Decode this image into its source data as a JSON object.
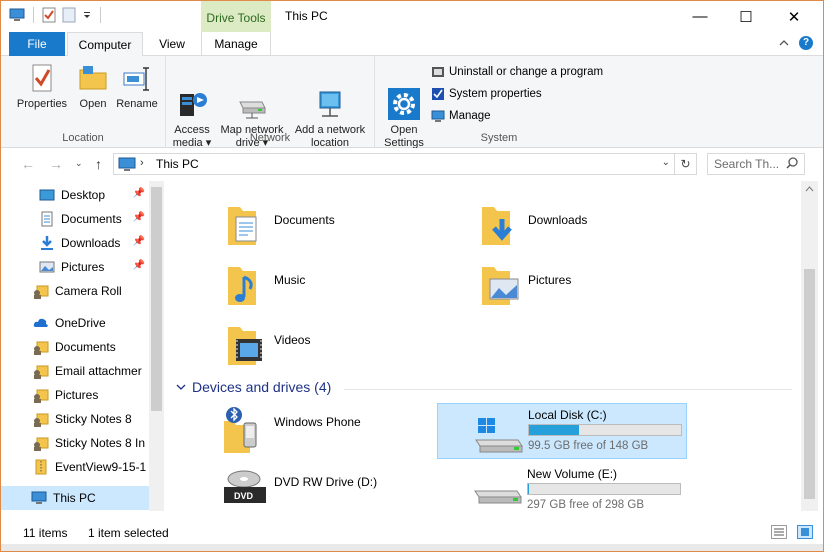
{
  "titlebar": {
    "contextual_tab": "Drive Tools",
    "title": "This PC",
    "minimize": "—",
    "maximize": "☐",
    "close": "✕"
  },
  "tabs": {
    "file": "File",
    "computer": "Computer",
    "view": "View",
    "manage": "Manage"
  },
  "ribbon": {
    "location": {
      "label": "Location",
      "properties": "Properties",
      "open": "Open",
      "rename": "Rename"
    },
    "network": {
      "label": "Network",
      "access_media": "Access\nmedia ▾",
      "map_drive": "Map network\ndrive ▾",
      "add_location": "Add a network\nlocation"
    },
    "system": {
      "label": "System",
      "open_settings": "Open\nSettings",
      "uninstall": "Uninstall or change a program",
      "system_properties": "System properties",
      "manage": "Manage"
    }
  },
  "address": {
    "crumb": "This PC",
    "search_placeholder": "Search Th..."
  },
  "navpane": {
    "items": [
      {
        "label": "Desktop",
        "pinned": true
      },
      {
        "label": "Documents",
        "pinned": true
      },
      {
        "label": "Downloads",
        "pinned": true
      },
      {
        "label": "Pictures",
        "pinned": true
      },
      {
        "label": "Camera Roll",
        "pinned": false
      },
      {
        "label": "OneDrive",
        "pinned": false
      },
      {
        "label": "Documents",
        "pinned": false
      },
      {
        "label": "Email attachmer",
        "pinned": false
      },
      {
        "label": "Pictures",
        "pinned": false
      },
      {
        "label": "Sticky Notes 8",
        "pinned": false
      },
      {
        "label": "Sticky Notes 8 In",
        "pinned": false
      },
      {
        "label": "EventView9-15-1",
        "pinned": false
      },
      {
        "label": "This PC",
        "pinned": false
      }
    ]
  },
  "folders": [
    {
      "name": "Documents"
    },
    {
      "name": "Downloads"
    },
    {
      "name": "Music"
    },
    {
      "name": "Pictures"
    },
    {
      "name": "Videos"
    }
  ],
  "devices": {
    "heading": "Devices and drives (4)",
    "items": [
      {
        "name": "Windows Phone"
      },
      {
        "name": "Local Disk (C:)",
        "free_text": "99.5 GB free of 148 GB",
        "used_fraction": 0.328
      },
      {
        "name": "DVD RW Drive (D:)"
      },
      {
        "name": "New Volume (E:)",
        "free_text": "297 GB free of 298 GB",
        "used_fraction": 0.003
      }
    ]
  },
  "status": {
    "items_count": "11 items",
    "selected": "1 item selected"
  },
  "colors": {
    "accent": "#1979ca",
    "selection": "#cce8ff",
    "progress": "#26a0da",
    "context_tab": "#dcebc4"
  }
}
